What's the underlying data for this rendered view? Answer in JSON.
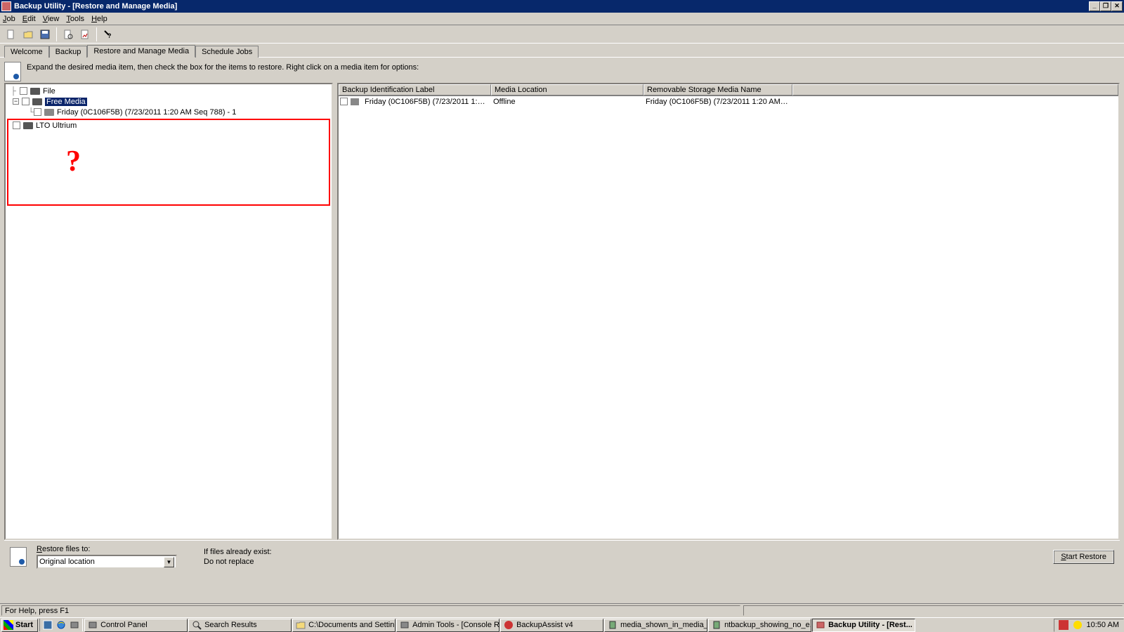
{
  "window": {
    "title": "Backup Utility - [Restore and Manage Media]",
    "min": "_",
    "max": "❐",
    "close": "✕"
  },
  "menu": {
    "job": "Job",
    "edit": "Edit",
    "view": "View",
    "tools": "Tools",
    "help": "Help"
  },
  "tabs": {
    "welcome": "Welcome",
    "backup": "Backup",
    "restore": "Restore and Manage Media",
    "schedule": "Schedule Jobs"
  },
  "instruction": "Expand the desired media item, then check the box for the items to restore. Right click on a media item for options:",
  "tree": {
    "file": "File",
    "free_media": "Free Media",
    "friday": "Friday (0C106F5B) (7/23/2011 1:20 AM Seq 788) - 1",
    "lto": "LTO Ultrium"
  },
  "annotation": "?",
  "list": {
    "cols": {
      "label": "Backup Identification Label",
      "location": "Media Location",
      "name": "Removable Storage Media Name"
    },
    "row": {
      "label": "Friday (0C106F5B) (7/23/2011 1:20 AM...",
      "location": "Offline",
      "name": "Friday (0C106F5B) (7/23/2011 1:20 AM Seq 7..."
    }
  },
  "restore": {
    "rlabel": "Restore files to:",
    "rvalue": "Original location",
    "exist_label": "If files already exist:",
    "exist_value": "Do not replace",
    "button": "Start Restore"
  },
  "status": "For Help, press F1",
  "taskbar": {
    "start": "Start",
    "items": [
      "Control Panel",
      "Search Results",
      "C:\\Documents and Settin...",
      "Admin Tools - [Console R...",
      "BackupAssist v4",
      "media_shown_in_media_...",
      "ntbackup_showing_no_e...",
      "Backup Utility - [Rest..."
    ],
    "time": "10:50 AM"
  }
}
